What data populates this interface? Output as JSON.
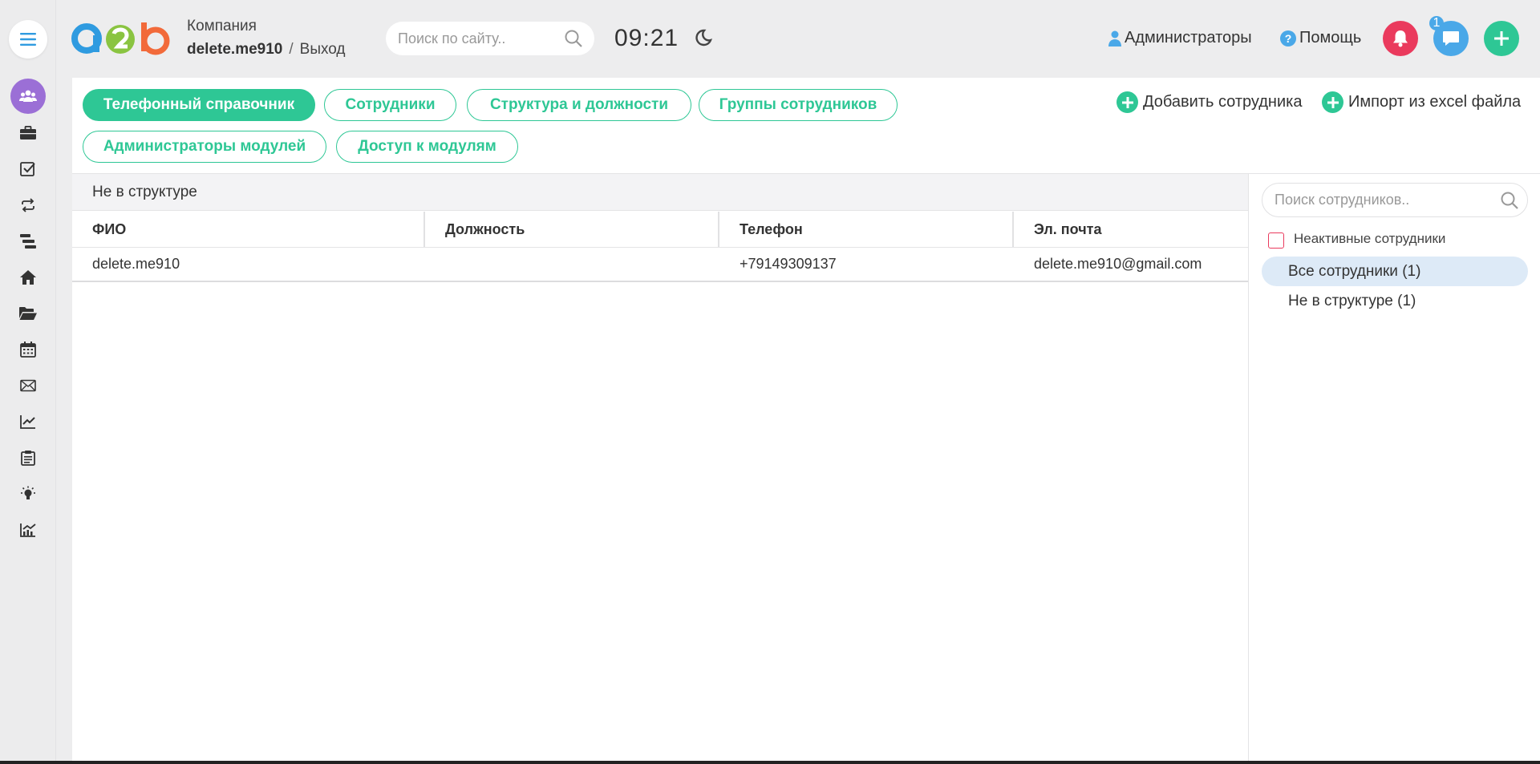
{
  "header": {
    "company_label": "Компания",
    "user": "delete.me910",
    "separator": "/",
    "logout": "Выход",
    "search_placeholder": "Поиск по сайту..",
    "time": "09:21",
    "admins_label": "Администраторы",
    "help_label": "Помощь",
    "chat_badge": "1"
  },
  "sidebar": {
    "icons": [
      "menu-icon",
      "users-icon",
      "briefcase-icon",
      "checkbox-icon",
      "exchange-icon",
      "tasks-icon",
      "home-icon",
      "folder-icon",
      "calendar-icon",
      "mail-icon",
      "chart-line-icon",
      "clipboard-icon",
      "lightbulb-icon",
      "analytics-icon"
    ]
  },
  "tabs": [
    {
      "label": "Телефонный справочник",
      "active": true
    },
    {
      "label": "Сотрудники",
      "active": false
    },
    {
      "label": "Структура и должности",
      "active": false
    },
    {
      "label": "Группы сотрудников",
      "active": false
    },
    {
      "label": "Администраторы модулей",
      "active": false
    },
    {
      "label": "Доступ к модулям",
      "active": false
    }
  ],
  "actions": {
    "add_employee": "Добавить сотрудника",
    "import_excel": "Импорт из excel файла"
  },
  "section_title": "Не в структуре",
  "table": {
    "columns": [
      "ФИО",
      "Должность",
      "Телефон",
      "Эл. почта"
    ],
    "rows": [
      {
        "name": "delete.me910",
        "position": "",
        "phone": "+79149309137",
        "email": "delete.me910@gmail.com"
      }
    ]
  },
  "right_panel": {
    "search_placeholder": "Поиск сотрудников..",
    "inactive_label": "Неактивные сотрудники",
    "filters": [
      {
        "label": "Все сотрудники (1)",
        "selected": true
      },
      {
        "label": "Не в структуре (1)",
        "selected": false
      }
    ]
  },
  "colors": {
    "accent_green": "#2ec795",
    "bell_red": "#ea3a5d",
    "chat_blue": "#4aa8e8",
    "sidebar_active_purple": "#9b6fd6",
    "selected_filter_bg": "#ddeaf7"
  }
}
